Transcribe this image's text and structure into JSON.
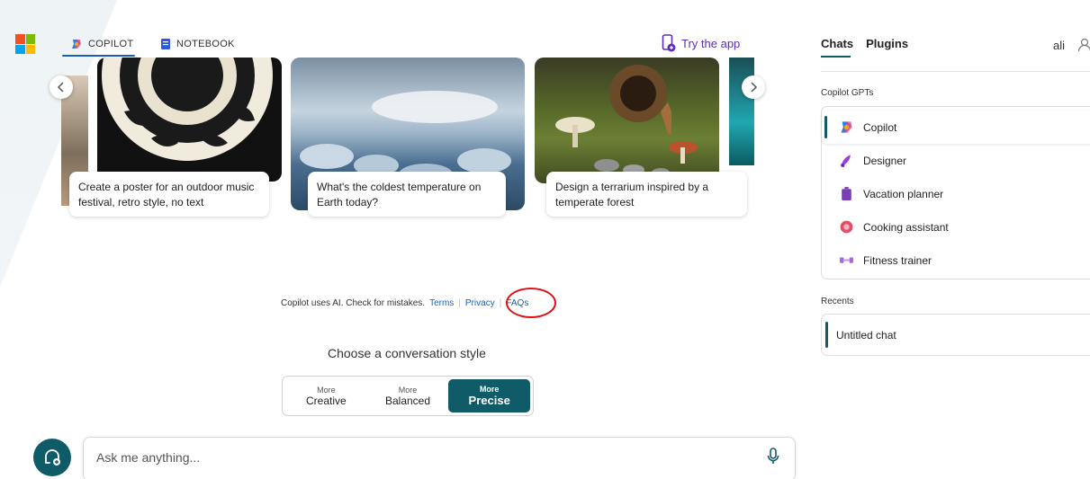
{
  "nav": {
    "copilot_tab": "COPILOT",
    "notebook_tab": "NOTEBOOK",
    "try_app": "Try the app"
  },
  "carousel": {
    "cards": [
      {
        "caption": "Create a poster for an outdoor music festival, retro style, no text",
        "image": "poster-image"
      },
      {
        "caption": "What's the coldest temperature on Earth today?",
        "image": "frozen-landscape-image"
      },
      {
        "caption": "Design a terrarium inspired by a temperate forest",
        "image": "terrarium-image"
      }
    ]
  },
  "disclaimer": {
    "text": "Copilot uses AI. Check for mistakes.",
    "terms": "Terms",
    "privacy": "Privacy",
    "faqs": "FAQs"
  },
  "conversation_style": {
    "title": "Choose a conversation style",
    "options": [
      {
        "prefix": "More",
        "label": "Creative",
        "active": false
      },
      {
        "prefix": "More",
        "label": "Balanced",
        "active": false
      },
      {
        "prefix": "More",
        "label": "Precise",
        "active": true
      }
    ]
  },
  "input": {
    "placeholder": "Ask me anything..."
  },
  "right_panel": {
    "tabs": [
      "Chats",
      "Plugins"
    ],
    "user_name": "ali",
    "gpts_label": "Copilot GPTs",
    "gpts": [
      {
        "label": "Copilot",
        "icon": "copilot-icon",
        "active": true
      },
      {
        "label": "Designer",
        "icon": "designer-icon",
        "active": false
      },
      {
        "label": "Vacation planner",
        "icon": "suitcase-icon",
        "active": false
      },
      {
        "label": "Cooking assistant",
        "icon": "cooking-icon",
        "active": false
      },
      {
        "label": "Fitness trainer",
        "icon": "dumbbell-icon",
        "active": false
      }
    ],
    "recents_label": "Recents",
    "recents": [
      "Untitled chat"
    ]
  },
  "colors": {
    "accent_teal": "#0f5c68",
    "link_blue": "#1c5fb0",
    "try_app_purple": "#5b2fb3",
    "annotation_red": "#e01010"
  }
}
